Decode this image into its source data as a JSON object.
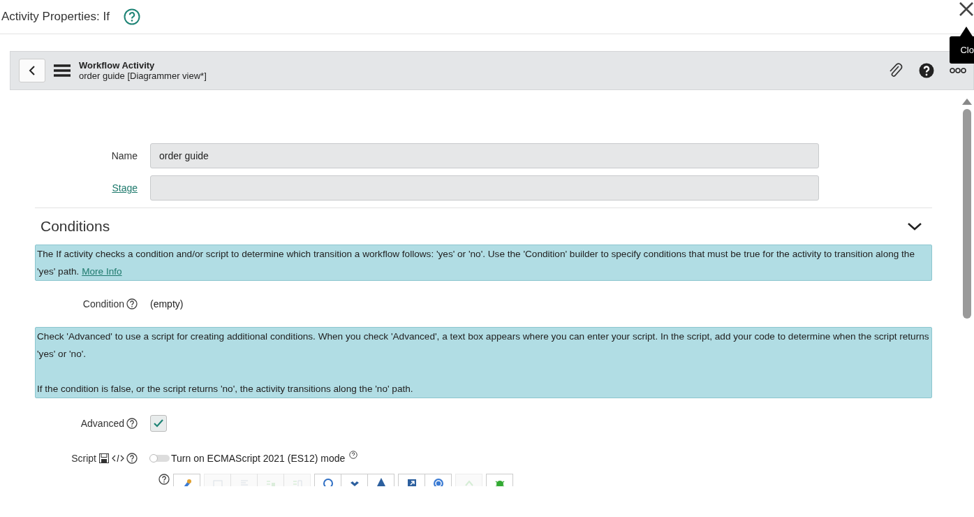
{
  "dialog": {
    "title": "Activity Properties: If",
    "tooltip": "Clo"
  },
  "header": {
    "title": "Workflow Activity",
    "subtitle": "order guide [Diagrammer view*]"
  },
  "fields": [
    {
      "label": "Name",
      "value": "order guide",
      "link": false
    },
    {
      "label": "Stage",
      "link": true
    }
  ],
  "section": {
    "title": "Conditions",
    "expanded": true
  },
  "info_1": {
    "text": "The If activity checks a condition and/or script to determine which transition a workflow follows: 'yes' or 'no'. Use the 'Condition' builder to specify conditions that must be true for the activity to transition along the 'yes' path.",
    "link": "More Info"
  },
  "condition": {
    "label": "Condition",
    "value": "(empty)"
  },
  "info_2": {
    "paragraphs": [
      "Check 'Advanced' to use a script for creating additional conditions. When you check 'Advanced', a text box appears where you can enter your script. In the script, add your code to determine when the script returns 'yes' or 'no'.",
      "If the condition is false, or the script returns 'no', the activity transitions along the 'no' path."
    ]
  },
  "advanced": {
    "label": "Advanced",
    "checked": true
  },
  "script": {
    "label": "Script",
    "toggle_label": "Turn on ECMAScript 2021 (ES12) mode",
    "on": false
  },
  "toolbar": [
    [
      {
        "disabled": false
      }
    ],
    [
      {
        "disabled": true
      },
      {
        "disabled": true
      },
      {
        "disabled": true
      },
      {
        "disabled": true
      }
    ],
    [
      {
        "disabled": false
      },
      {
        "disabled": false
      },
      {
        "disabled": false
      }
    ],
    [
      {
        "disabled": false
      },
      {
        "disabled": false
      }
    ],
    [
      {
        "disabled": true
      }
    ],
    [
      {
        "disabled": false
      }
    ]
  ]
}
